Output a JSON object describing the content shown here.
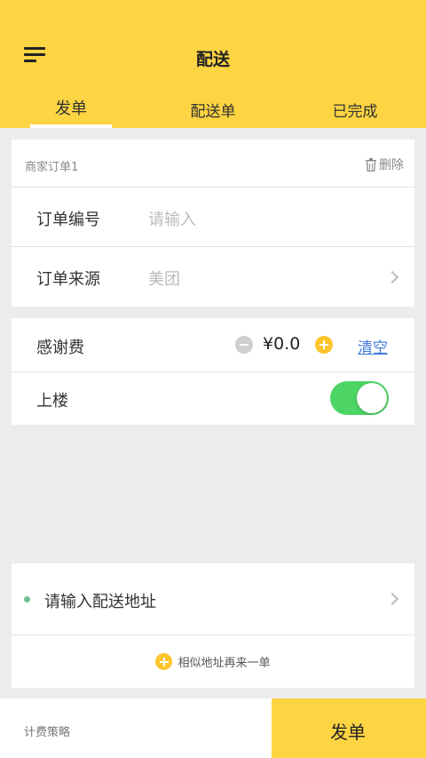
{
  "header": {
    "title": "配送",
    "tabs": [
      {
        "label": "发单",
        "active": true
      },
      {
        "label": "配送单",
        "active": false
      },
      {
        "label": "已完成",
        "active": false
      }
    ]
  },
  "order_card": {
    "section_title": "商家订单1",
    "delete_label": "删除",
    "order_number_label": "订单编号",
    "order_number_placeholder": "请输入",
    "order_source_label": "订单来源",
    "order_source_value": "美团"
  },
  "tip_card": {
    "tip_label": "感谢费",
    "tip_amount": "¥0.0",
    "clear_label": "清空",
    "upstairs_label": "上楼",
    "upstairs_enabled": true
  },
  "address_card": {
    "address_placeholder": "请输入配送地址",
    "similar_label": "相似地址再来一单"
  },
  "bottom": {
    "pricing_label": "计费策略",
    "submit_label": "发单"
  },
  "colors": {
    "brand_yellow": "#fdd442",
    "toggle_green": "#4cd564",
    "link_blue": "#3d7bd8",
    "dot_green": "#6cc08b"
  }
}
